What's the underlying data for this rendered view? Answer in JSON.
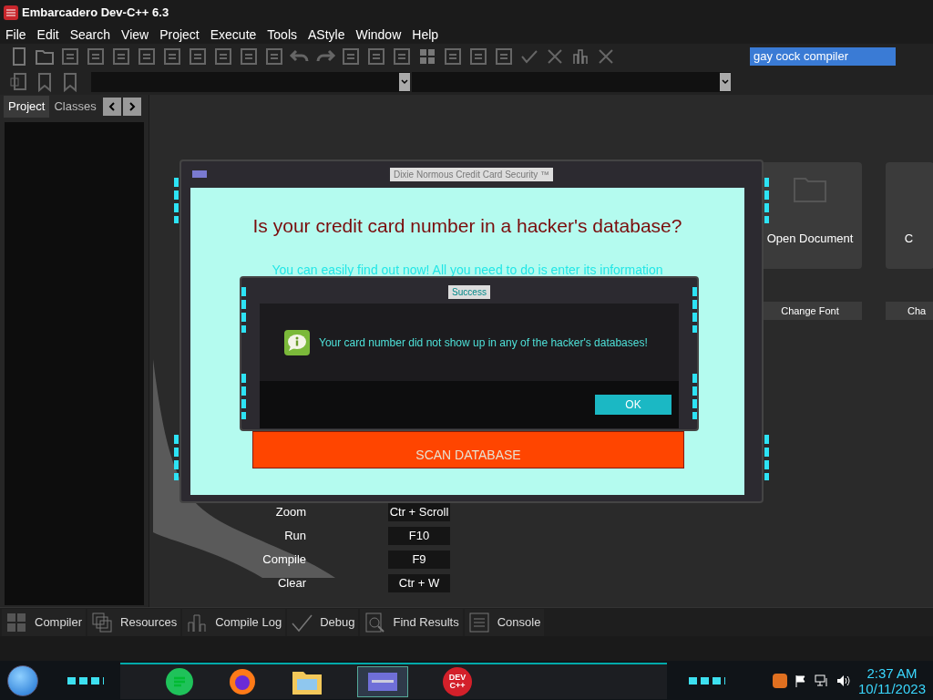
{
  "window": {
    "title": "Embarcadero Dev-C++ 6.3"
  },
  "menu": [
    "File",
    "Edit",
    "Search",
    "View",
    "Project",
    "Execute",
    "Tools",
    "AStyle",
    "Window",
    "Help"
  ],
  "search": {
    "value": "gay cock compiler"
  },
  "side_tabs": [
    {
      "label": "Project",
      "selected": true
    },
    {
      "label": "Classes",
      "selected": false
    }
  ],
  "welcome": {
    "cards": [
      "Open Document",
      "C"
    ],
    "buttons": [
      "Change Font",
      "Cha"
    ],
    "shortcuts": [
      {
        "action": "Zoom",
        "keys": "Ctr + Scroll"
      },
      {
        "action": "Run",
        "keys": "F10"
      },
      {
        "action": "Compile",
        "keys": "F9"
      },
      {
        "action": "Clear",
        "keys": "Ctr + W"
      }
    ]
  },
  "bottom_tabs": [
    "Compiler",
    "Resources",
    "Compile Log",
    "Debug",
    "Find Results",
    "Console"
  ],
  "app_dialog": {
    "title": "Dixie Normous Credit Card Security ™",
    "heading": "Is your credit card number in a hacker's database?",
    "subtitle": "You can easily find out now! All you need to do is enter its information",
    "scan_button": "SCAN DATABASE"
  },
  "message_box": {
    "title": "Success",
    "message": "Your card number did not show up in any of the hacker's databases!",
    "ok_button": "OK"
  },
  "taskbar": {
    "dev_icon_text": "DEV C++",
    "time": "2:37 AM",
    "date": "10/11/2023"
  }
}
